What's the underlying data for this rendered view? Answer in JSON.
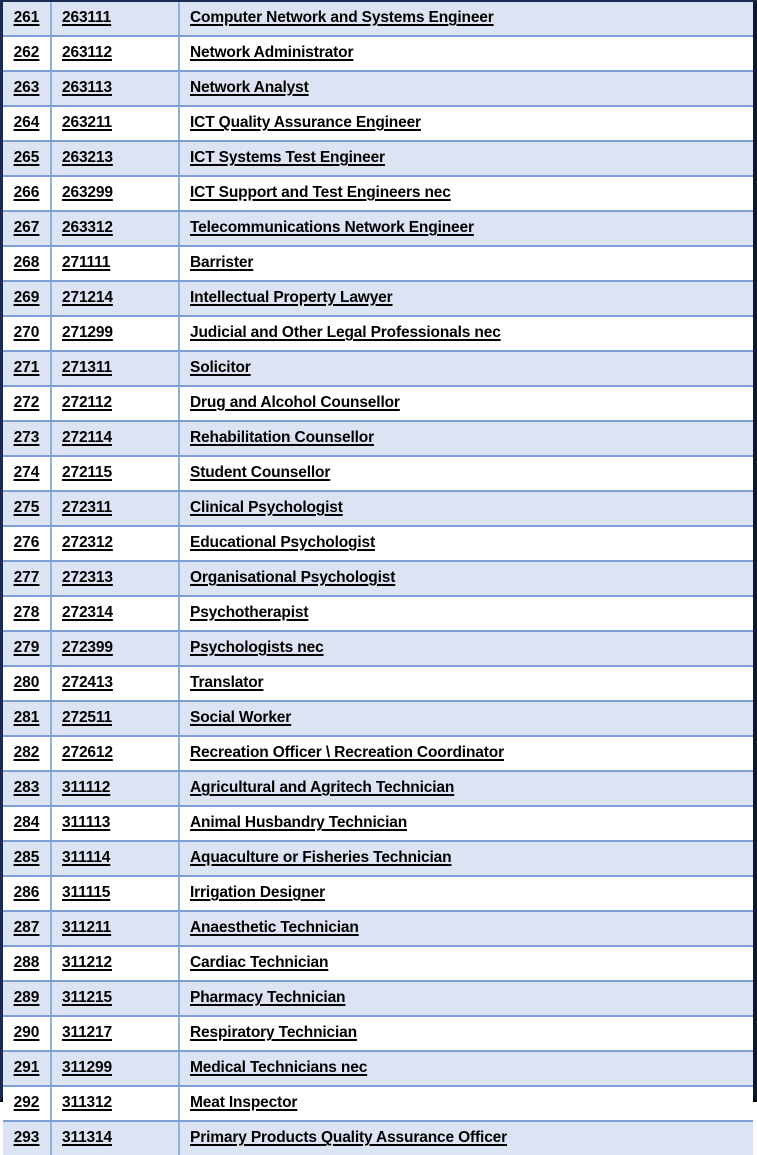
{
  "document": {
    "type": "occupation-list-table",
    "columns": [
      "index",
      "code",
      "title"
    ],
    "colors": {
      "row_shaded_background": "#dce3f3",
      "row_plain_background": "#ffffff",
      "row_separator": "#7d9fd6",
      "column_separator": "#93aedd",
      "frame_border": "#1b2a52",
      "bottom_border": "#000000",
      "text": "#000000"
    }
  },
  "rows": [
    {
      "index": "261",
      "code": "263111",
      "title": "Computer Network and Systems Engineer"
    },
    {
      "index": "262",
      "code": "263112",
      "title": "Network Administrator"
    },
    {
      "index": "263",
      "code": "263113",
      "title": "Network Analyst"
    },
    {
      "index": "264",
      "code": "263211",
      "title": "ICT Quality Assurance Engineer"
    },
    {
      "index": "265",
      "code": "263213",
      "title": "ICT Systems Test Engineer"
    },
    {
      "index": "266",
      "code": "263299",
      "title": "ICT Support and Test Engineers nec"
    },
    {
      "index": "267",
      "code": "263312",
      "title": "Telecommunications Network Engineer"
    },
    {
      "index": "268",
      "code": "271111",
      "title": "Barrister"
    },
    {
      "index": "269",
      "code": "271214",
      "title": "Intellectual Property Lawyer"
    },
    {
      "index": "270",
      "code": "271299",
      "title": "Judicial and Other Legal Professionals nec"
    },
    {
      "index": "271",
      "code": "271311",
      "title": "Solicitor"
    },
    {
      "index": "272",
      "code": "272112",
      "title": "Drug and Alcohol Counsellor"
    },
    {
      "index": "273",
      "code": "272114",
      "title": "Rehabilitation Counsellor"
    },
    {
      "index": "274",
      "code": "272115",
      "title": "Student Counsellor"
    },
    {
      "index": "275",
      "code": "272311",
      "title": "Clinical Psychologist"
    },
    {
      "index": "276",
      "code": "272312",
      "title": "Educational Psychologist"
    },
    {
      "index": "277",
      "code": "272313",
      "title": "Organisational Psychologist"
    },
    {
      "index": "278",
      "code": "272314",
      "title": "Psychotherapist"
    },
    {
      "index": "279",
      "code": "272399",
      "title": "Psychologists nec"
    },
    {
      "index": "280",
      "code": "272413",
      "title": "Translator"
    },
    {
      "index": "281",
      "code": "272511",
      "title": "Social Worker"
    },
    {
      "index": "282",
      "code": "272612",
      "title": "Recreation Officer \\ Recreation Coordinator"
    },
    {
      "index": "283",
      "code": "311112",
      "title": "Agricultural and Agritech Technician"
    },
    {
      "index": "284",
      "code": "311113",
      "title": "Animal Husbandry Technician"
    },
    {
      "index": "285",
      "code": "311114",
      "title": "Aquaculture or Fisheries Technician"
    },
    {
      "index": "286",
      "code": "311115",
      "title": "Irrigation Designer"
    },
    {
      "index": "287",
      "code": "311211",
      "title": "Anaesthetic Technician"
    },
    {
      "index": "288",
      "code": "311212",
      "title": "Cardiac Technician"
    },
    {
      "index": "289",
      "code": "311215",
      "title": "Pharmacy Technician"
    },
    {
      "index": "290",
      "code": "311217",
      "title": "Respiratory Technician"
    },
    {
      "index": "291",
      "code": "311299",
      "title": "Medical Technicians nec"
    },
    {
      "index": "292",
      "code": "311312",
      "title": "Meat Inspector"
    },
    {
      "index": "293",
      "code": "311314",
      "title": "Primary Products Quality Assurance Officer"
    }
  ]
}
